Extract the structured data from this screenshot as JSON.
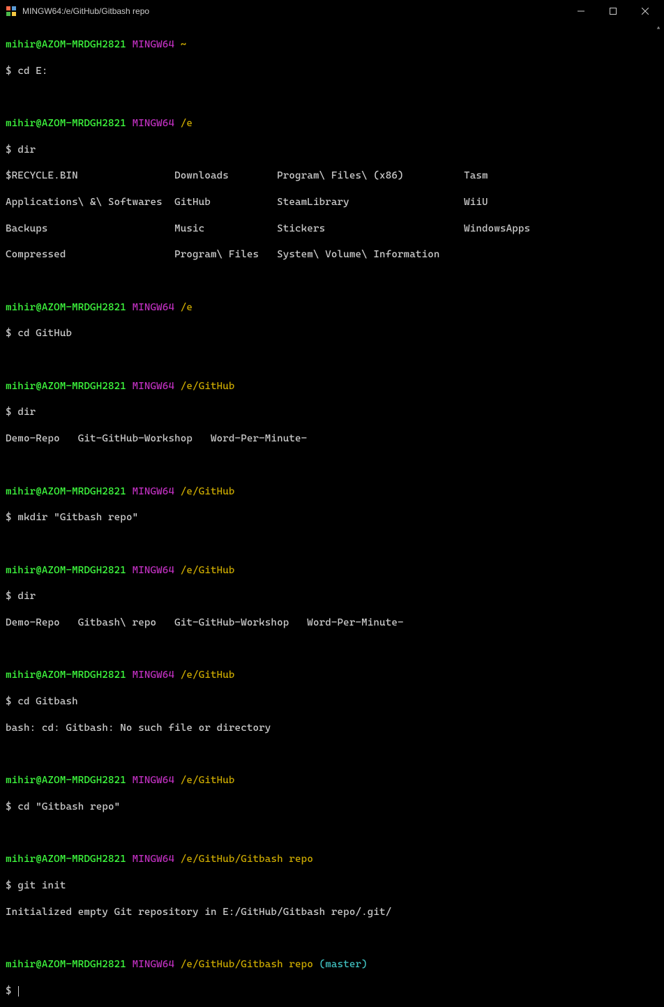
{
  "window": {
    "title": "MINGW64:/e/GitHub/Gitbash repo"
  },
  "prompts": {
    "user": "mihir@AZOM-MRDGH2821",
    "env": "MINGW64",
    "home": "~",
    "path_e": "/e",
    "path_github": "/e/GitHub",
    "path_repo": "/e/GitHub/Gitbash repo",
    "branch": "(master)",
    "dollar": "$"
  },
  "commands": {
    "cd_e": "cd E:",
    "dir": "dir",
    "cd_github": "cd GitHub",
    "mkdir": "mkdir \"Gitbash repo\"",
    "cd_gitbash": "cd Gitbash",
    "cd_gitbash_repo": "cd \"Gitbash repo\"",
    "git_init": "git init"
  },
  "output": {
    "dir_e_l1": "$RECYCLE.BIN                Downloads        Program\\ Files\\ (x86)          Tasm",
    "dir_e_l2": "Applications\\ &\\ Softwares  GitHub           SteamLibrary                   WiiU",
    "dir_e_l3": "Backups                     Music            Stickers                       WindowsApps",
    "dir_e_l4": "Compressed                  Program\\ Files   System\\ Volume\\ Information",
    "dir_github": "Demo-Repo   Git-GitHub-Workshop   Word-Per-Minute-",
    "dir_github2": "Demo-Repo   Gitbash\\ repo   Git-GitHub-Workshop   Word-Per-Minute-",
    "cd_error": "bash: cd: Gitbash: No such file or directory",
    "git_init_out": "Initialized empty Git repository in E:/GitHub/Gitbash repo/.git/"
  }
}
